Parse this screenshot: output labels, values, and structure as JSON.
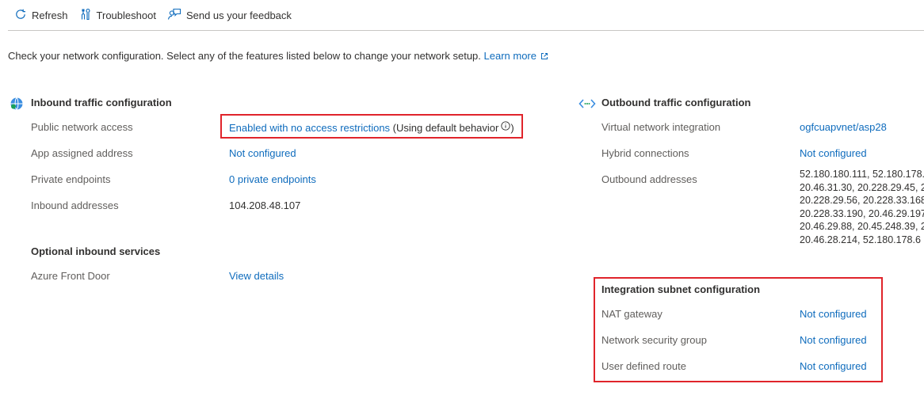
{
  "toolbar": {
    "refresh_label": "Refresh",
    "troubleshoot_label": "Troubleshoot",
    "feedback_label": "Send us your feedback"
  },
  "intro": {
    "text": "Check your network configuration. Select any of the features listed below to change your network setup.",
    "learn_more": "Learn more"
  },
  "inbound": {
    "title": "Inbound traffic configuration",
    "rows": [
      {
        "label": "Public network access",
        "value": "Enabled with no access restrictions",
        "suffix": "(Using default behavior"
      },
      {
        "label": "App assigned address",
        "value": "Not configured"
      },
      {
        "label": "Private endpoints",
        "value": "0 private endpoints"
      },
      {
        "label": "Inbound addresses",
        "value": "104.208.48.107"
      }
    ]
  },
  "optional": {
    "title": "Optional inbound services",
    "rows": [
      {
        "label": "Azure Front Door",
        "value": "View details"
      }
    ]
  },
  "outbound": {
    "title": "Outbound traffic configuration",
    "rows": [
      {
        "label": "Virtual network integration",
        "value": "ogfcuapvnet/asp28"
      },
      {
        "label": "Hybrid connections",
        "value": "Not configured"
      },
      {
        "label": "Outbound addresses"
      }
    ],
    "addresses": [
      "52.180.180.111, 52.180.178.",
      "20.46.31.30, 20.228.29.45, 2",
      "20.228.29.56, 20.228.33.168",
      "20.228.33.190, 20.46.29.197",
      "20.46.29.88, 20.45.248.39, 2",
      "20.46.28.214, 52.180.178.6"
    ]
  },
  "subnet": {
    "title": "Integration subnet configuration",
    "rows": [
      {
        "label": "NAT gateway",
        "value": "Not configured"
      },
      {
        "label": "Network security group",
        "value": "Not configured"
      },
      {
        "label": "User defined route",
        "value": "Not configured"
      }
    ]
  },
  "colors": {
    "link": "#0f6cbd",
    "highlight_border": "#e0242b",
    "divider": "#c8c6c4"
  },
  "icons": {
    "refresh": "refresh-icon",
    "troubleshoot": "troubleshoot-icon",
    "feedback": "feedback-icon",
    "external": "external-link-icon",
    "inbound": "globe-icon",
    "outbound": "arrows-icon",
    "info": "info-icon"
  }
}
